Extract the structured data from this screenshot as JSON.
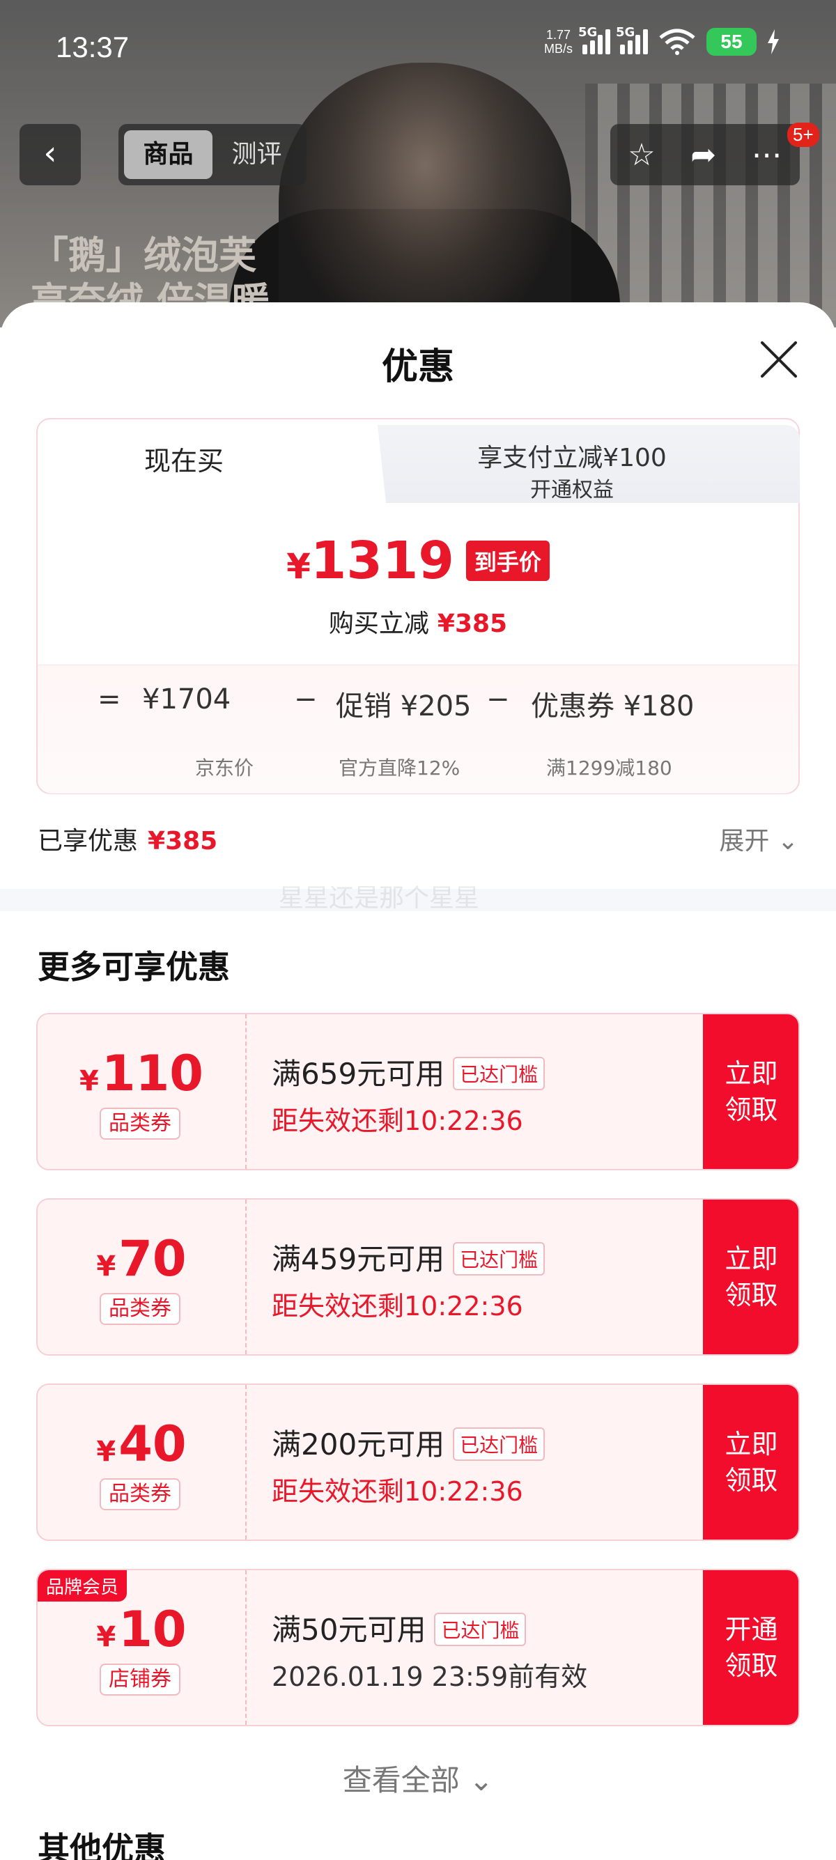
{
  "status_bar": {
    "time": "13:37",
    "net_speed_value": "1.77",
    "net_speed_unit": "MB/s",
    "signal1_label": "5G",
    "signal2_label": "5G",
    "battery": "55"
  },
  "product_nav": {
    "tabs": [
      "商品",
      "测评"
    ],
    "cart_badge": "5+",
    "slogan_line1": "「鹅」绒泡芙",
    "slogan_line2": "高奈绒 倍温暖"
  },
  "sheet": {
    "title": "优惠",
    "tab_now": "现在买",
    "tab_alt_title": "享支付立减¥100",
    "tab_alt_sub": "开通权益",
    "price_symbol": "¥",
    "price": "1319",
    "price_tag": "到手价",
    "instant_label": "购买立减",
    "instant_value": "¥385",
    "breakdown": {
      "equals": "=",
      "minus": "−",
      "jd_price": "¥1704",
      "jd_label": "京东价",
      "promo": "促销 ¥205",
      "promo_label": "官方直降12%",
      "coupon": "优惠券 ¥180",
      "coupon_label": "满1299减180"
    },
    "enjoyed_label": "已享优惠",
    "enjoyed_value": "¥385",
    "expand_label": "展开",
    "watermark": "星星还是那个星星",
    "more_title": "更多可享优惠",
    "coupons": [
      {
        "symbol": "¥",
        "amount": "110",
        "kind": "品类券",
        "condition": "满659元可用",
        "reached": "已达门槛",
        "expire": "距失效还剩10:22:36",
        "action_line1": "立即",
        "action_line2": "领取"
      },
      {
        "symbol": "¥",
        "amount": "70",
        "kind": "品类券",
        "condition": "满459元可用",
        "reached": "已达门槛",
        "expire": "距失效还剩10:22:36",
        "action_line1": "立即",
        "action_line2": "领取"
      },
      {
        "symbol": "¥",
        "amount": "40",
        "kind": "品类券",
        "condition": "满200元可用",
        "reached": "已达门槛",
        "expire": "距失效还剩10:22:36",
        "action_line1": "立即",
        "action_line2": "领取"
      },
      {
        "symbol": "¥",
        "amount": "10",
        "kind": "店铺券",
        "member_tag": "品牌会员",
        "condition": "满50元可用",
        "reached": "已达门槛",
        "expire": "2026.01.19 23:59前有效",
        "action_line1": "开通",
        "action_line2": "领取"
      }
    ],
    "view_all": "查看全部",
    "other_title": "其他优惠"
  },
  "colors": {
    "accent_red": "#e8172a",
    "button_red": "#f30d2c",
    "battery_green": "#34c759"
  }
}
